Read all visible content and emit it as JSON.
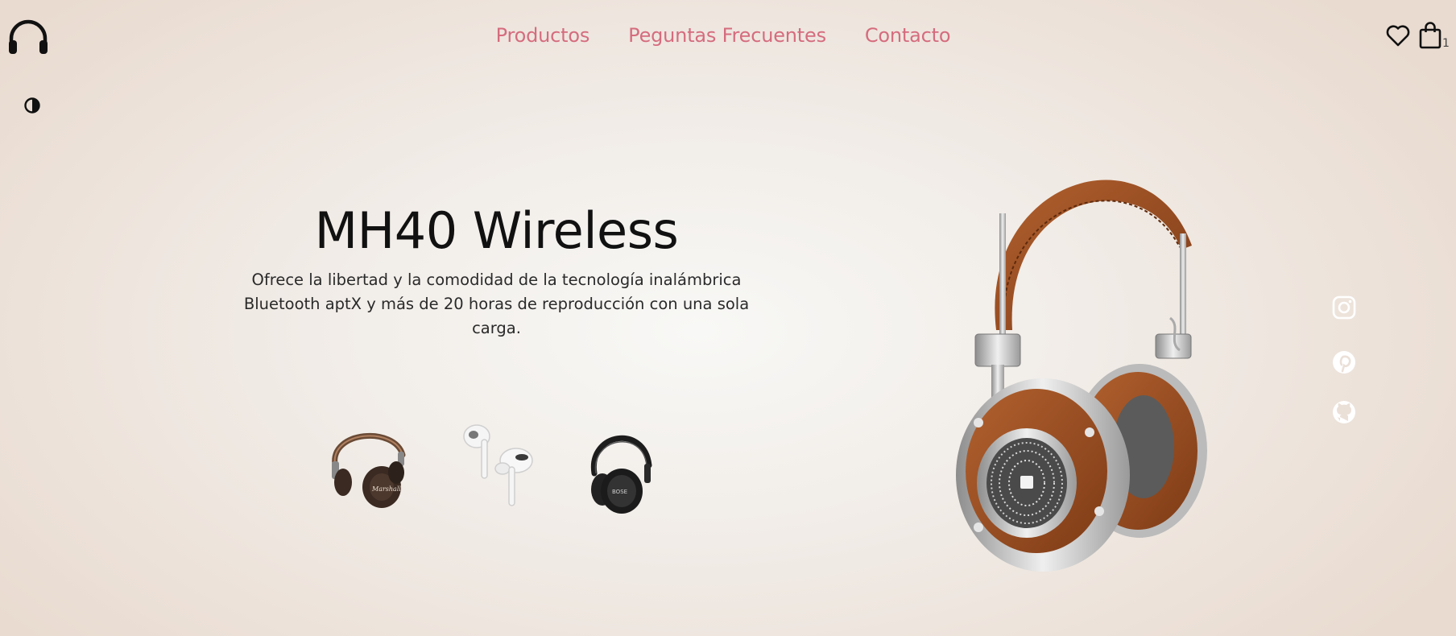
{
  "brand": {
    "logo_icon": "headphones-icon"
  },
  "theme_toggle": {
    "icon": "contrast-icon"
  },
  "nav": {
    "items": [
      {
        "label": "Productos"
      },
      {
        "label": "Peguntas Frecuentes"
      },
      {
        "label": "Contacto"
      }
    ],
    "link_color": "#d56c7e"
  },
  "header_actions": {
    "favorites_icon": "heart-icon",
    "cart_icon": "shopping-bag-icon",
    "cart_count": "1"
  },
  "hero": {
    "title": "MH40 Wireless",
    "description": "Ofrece la libertad y la comodidad de la tecnología inalámbrica Bluetooth aptX y más de 20 horas de reproducción con una sola carga."
  },
  "thumbnails": [
    {
      "icon": "brown-headphones-thumbnail"
    },
    {
      "icon": "white-earbuds-thumbnail"
    },
    {
      "icon": "black-headphones-thumbnail"
    }
  ],
  "featured_product": {
    "icon": "brown-silver-headphones-image"
  },
  "social": [
    {
      "icon": "instagram-icon"
    },
    {
      "icon": "pinterest-icon"
    },
    {
      "icon": "github-icon"
    }
  ]
}
